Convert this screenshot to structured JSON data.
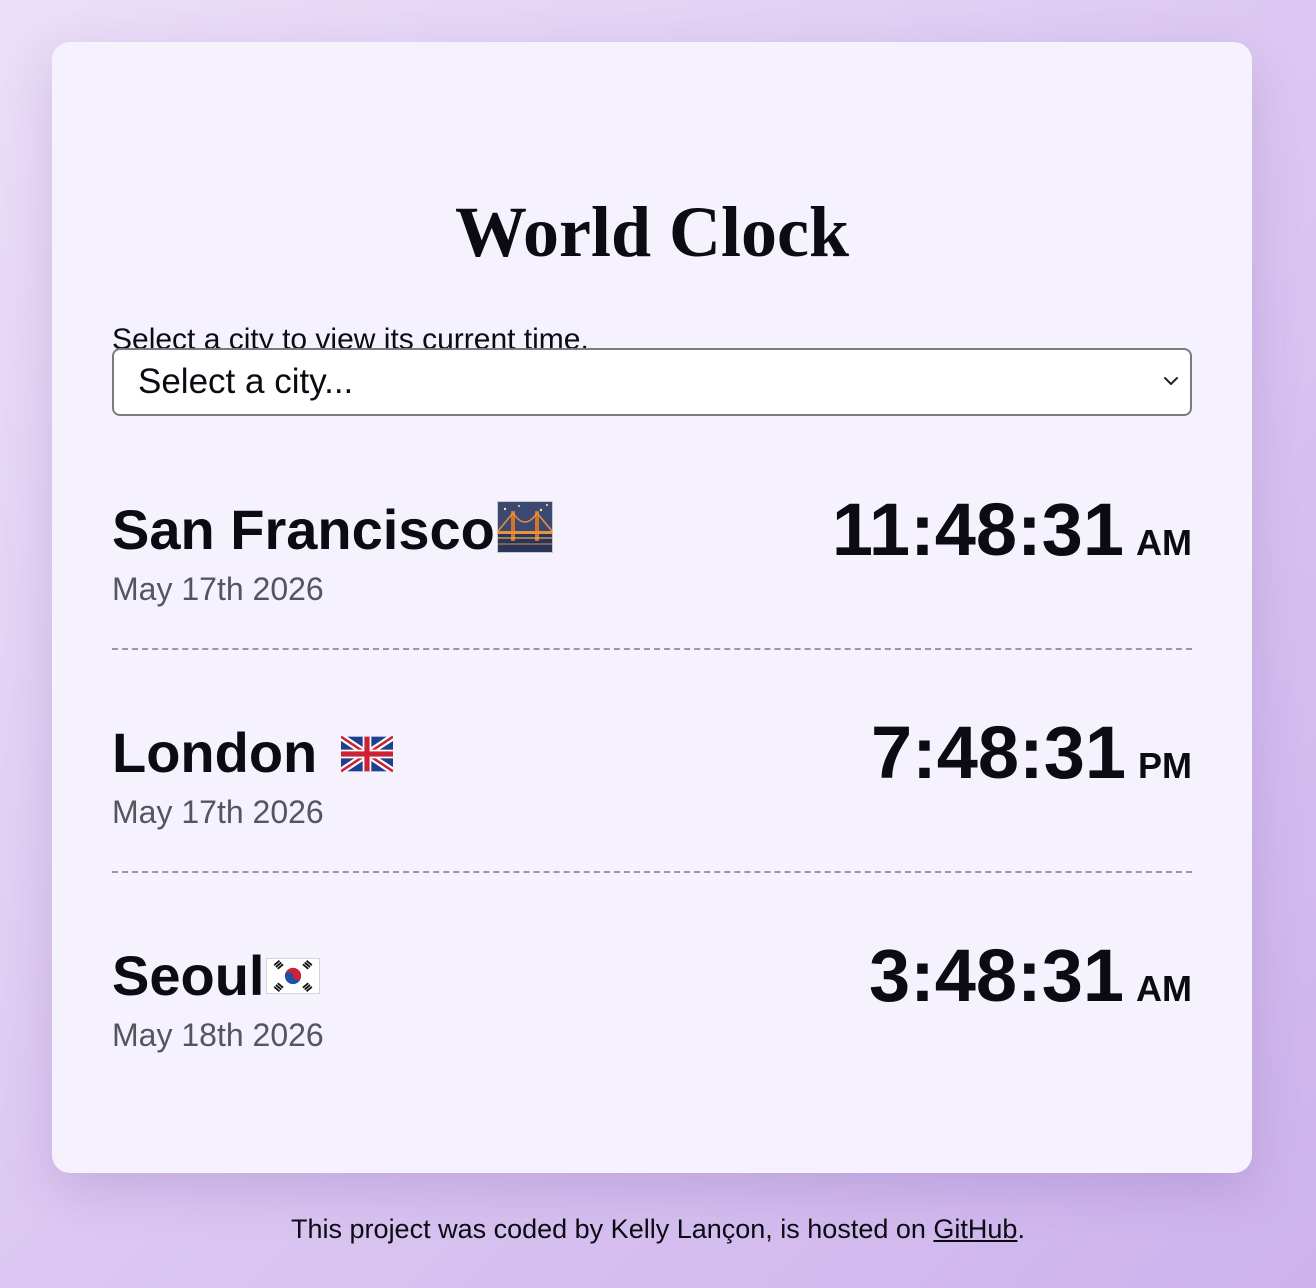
{
  "page": {
    "title": "World Clock",
    "intro": "Select a city to view its current time."
  },
  "city_select": {
    "selected_label": "Select a city..."
  },
  "cities": [
    {
      "name": "San Francisco",
      "icon": "bridge-at-night-icon",
      "date": "May 17th 2026",
      "time": "11:48:31",
      "ampm": "AM"
    },
    {
      "name": "London",
      "icon": "uk-flag-icon",
      "date": "May 17th 2026",
      "time": "7:48:31",
      "ampm": "PM"
    },
    {
      "name": "Seoul",
      "icon": "south-korea-flag-icon",
      "date": "May 18th 2026",
      "time": "3:48:31",
      "ampm": "AM"
    }
  ],
  "footer": {
    "text_before": "This project was coded by Kelly Lançon, is hosted on ",
    "link_label": "GitHub",
    "text_after": "."
  },
  "colors": {
    "background": "#dcc8f2",
    "card": "#f5f2fd",
    "text": "#0b0b12",
    "muted_text": "#55555e",
    "divider": "#9a96a6"
  }
}
